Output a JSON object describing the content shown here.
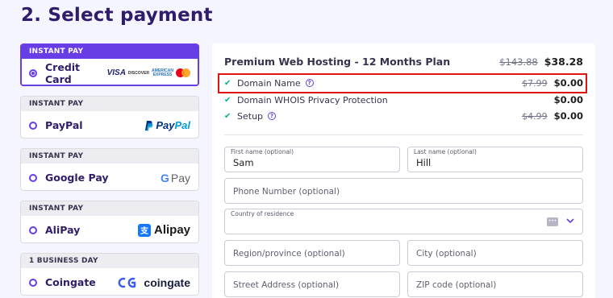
{
  "page": {
    "title": "2. Select payment"
  },
  "methods": [
    {
      "badge": "INSTANT PAY",
      "name": "Credit Card",
      "selected": true
    },
    {
      "badge": "INSTANT PAY",
      "name": "PayPal",
      "selected": false
    },
    {
      "badge": "INSTANT PAY",
      "name": "Google Pay",
      "selected": false
    },
    {
      "badge": "INSTANT PAY",
      "name": "AliPay",
      "selected": false
    },
    {
      "badge": "1 BUSINESS DAY",
      "name": "Coingate",
      "selected": false
    }
  ],
  "logos": {
    "visa": "VISA",
    "discover": "DISCOVER",
    "amex_1": "AMERICAN",
    "amex_2": "EXPRESS",
    "paypal_a": "Pay",
    "paypal_b": "Pal",
    "gpay_g": "G",
    "gpay_pay": "Pay",
    "alipay": "Alipay",
    "alipay_box": "支",
    "coingate": "coingate"
  },
  "order": {
    "plan_title": "Premium Web Hosting - 12 Months Plan",
    "plan_old_price": "$143.88",
    "plan_price": "$38.28",
    "items": [
      {
        "label": "Domain Name",
        "help": true,
        "old_price": "$7.99",
        "price": "$0.00"
      },
      {
        "label": "Domain WHOIS Privacy Protection",
        "help": false,
        "old_price": "",
        "price": "$0.00"
      },
      {
        "label": "Setup",
        "help": true,
        "old_price": "$4.99",
        "price": "$0.00"
      }
    ]
  },
  "form": {
    "first_name": {
      "label": "First name (optional)",
      "value": "Sam"
    },
    "last_name": {
      "label": "Last name (optional)",
      "value": "Hill"
    },
    "phone": {
      "placeholder": "Phone Number (optional)"
    },
    "country": {
      "label": "Country of residence",
      "value": ""
    },
    "region": {
      "placeholder": "Region/province (optional)"
    },
    "city": {
      "placeholder": "City (optional)"
    },
    "street": {
      "placeholder": "Street Address (optional)"
    },
    "zip": {
      "placeholder": "ZIP code (optional)"
    }
  },
  "colors": {
    "accent": "#673de6",
    "highlight": "#e11212",
    "check": "#00b090"
  }
}
